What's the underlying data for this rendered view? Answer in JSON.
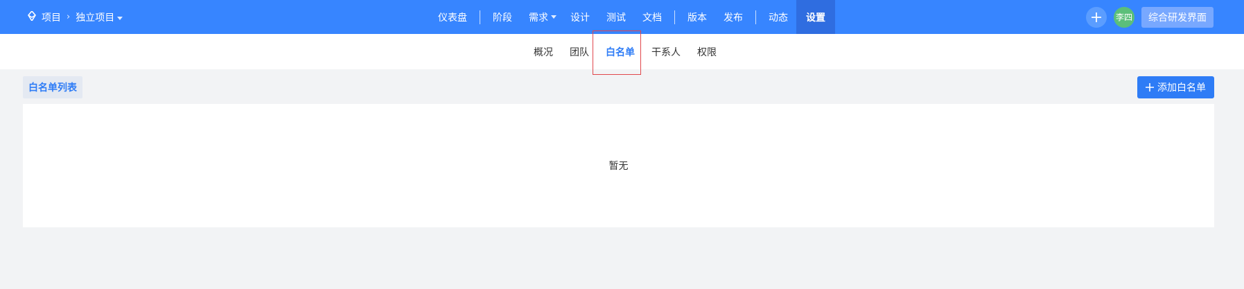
{
  "header": {
    "breadcrumb": {
      "root": "项目",
      "project": "独立项目"
    },
    "nav": [
      {
        "id": "dashboard",
        "label": "仪表盘"
      },
      {
        "id": "stage",
        "label": "阶段"
      },
      {
        "id": "requirements",
        "label": "需求"
      },
      {
        "id": "design",
        "label": "设计"
      },
      {
        "id": "test",
        "label": "测试"
      },
      {
        "id": "docs",
        "label": "文档"
      },
      {
        "id": "version",
        "label": "版本"
      },
      {
        "id": "release",
        "label": "发布"
      },
      {
        "id": "activity",
        "label": "动态"
      },
      {
        "id": "settings",
        "label": "设置"
      }
    ],
    "active_nav": "settings",
    "user": {
      "avatar_text": "李四"
    },
    "workspace_button": "综合研发界面"
  },
  "subnav": {
    "tabs": [
      {
        "id": "overview",
        "label": "概况"
      },
      {
        "id": "team",
        "label": "团队"
      },
      {
        "id": "whitelist",
        "label": "白名单"
      },
      {
        "id": "stakeholders",
        "label": "干系人"
      },
      {
        "id": "permissions",
        "label": "权限"
      }
    ],
    "active": "whitelist"
  },
  "main": {
    "list_title": "白名单列表",
    "add_button": "添加白名单",
    "empty_text": "暂无"
  },
  "colors": {
    "header_bg": "#3785ff",
    "active_nav_bg": "#2f6de0",
    "accent": "#2e7cf6",
    "highlight_border": "#e0464b"
  }
}
